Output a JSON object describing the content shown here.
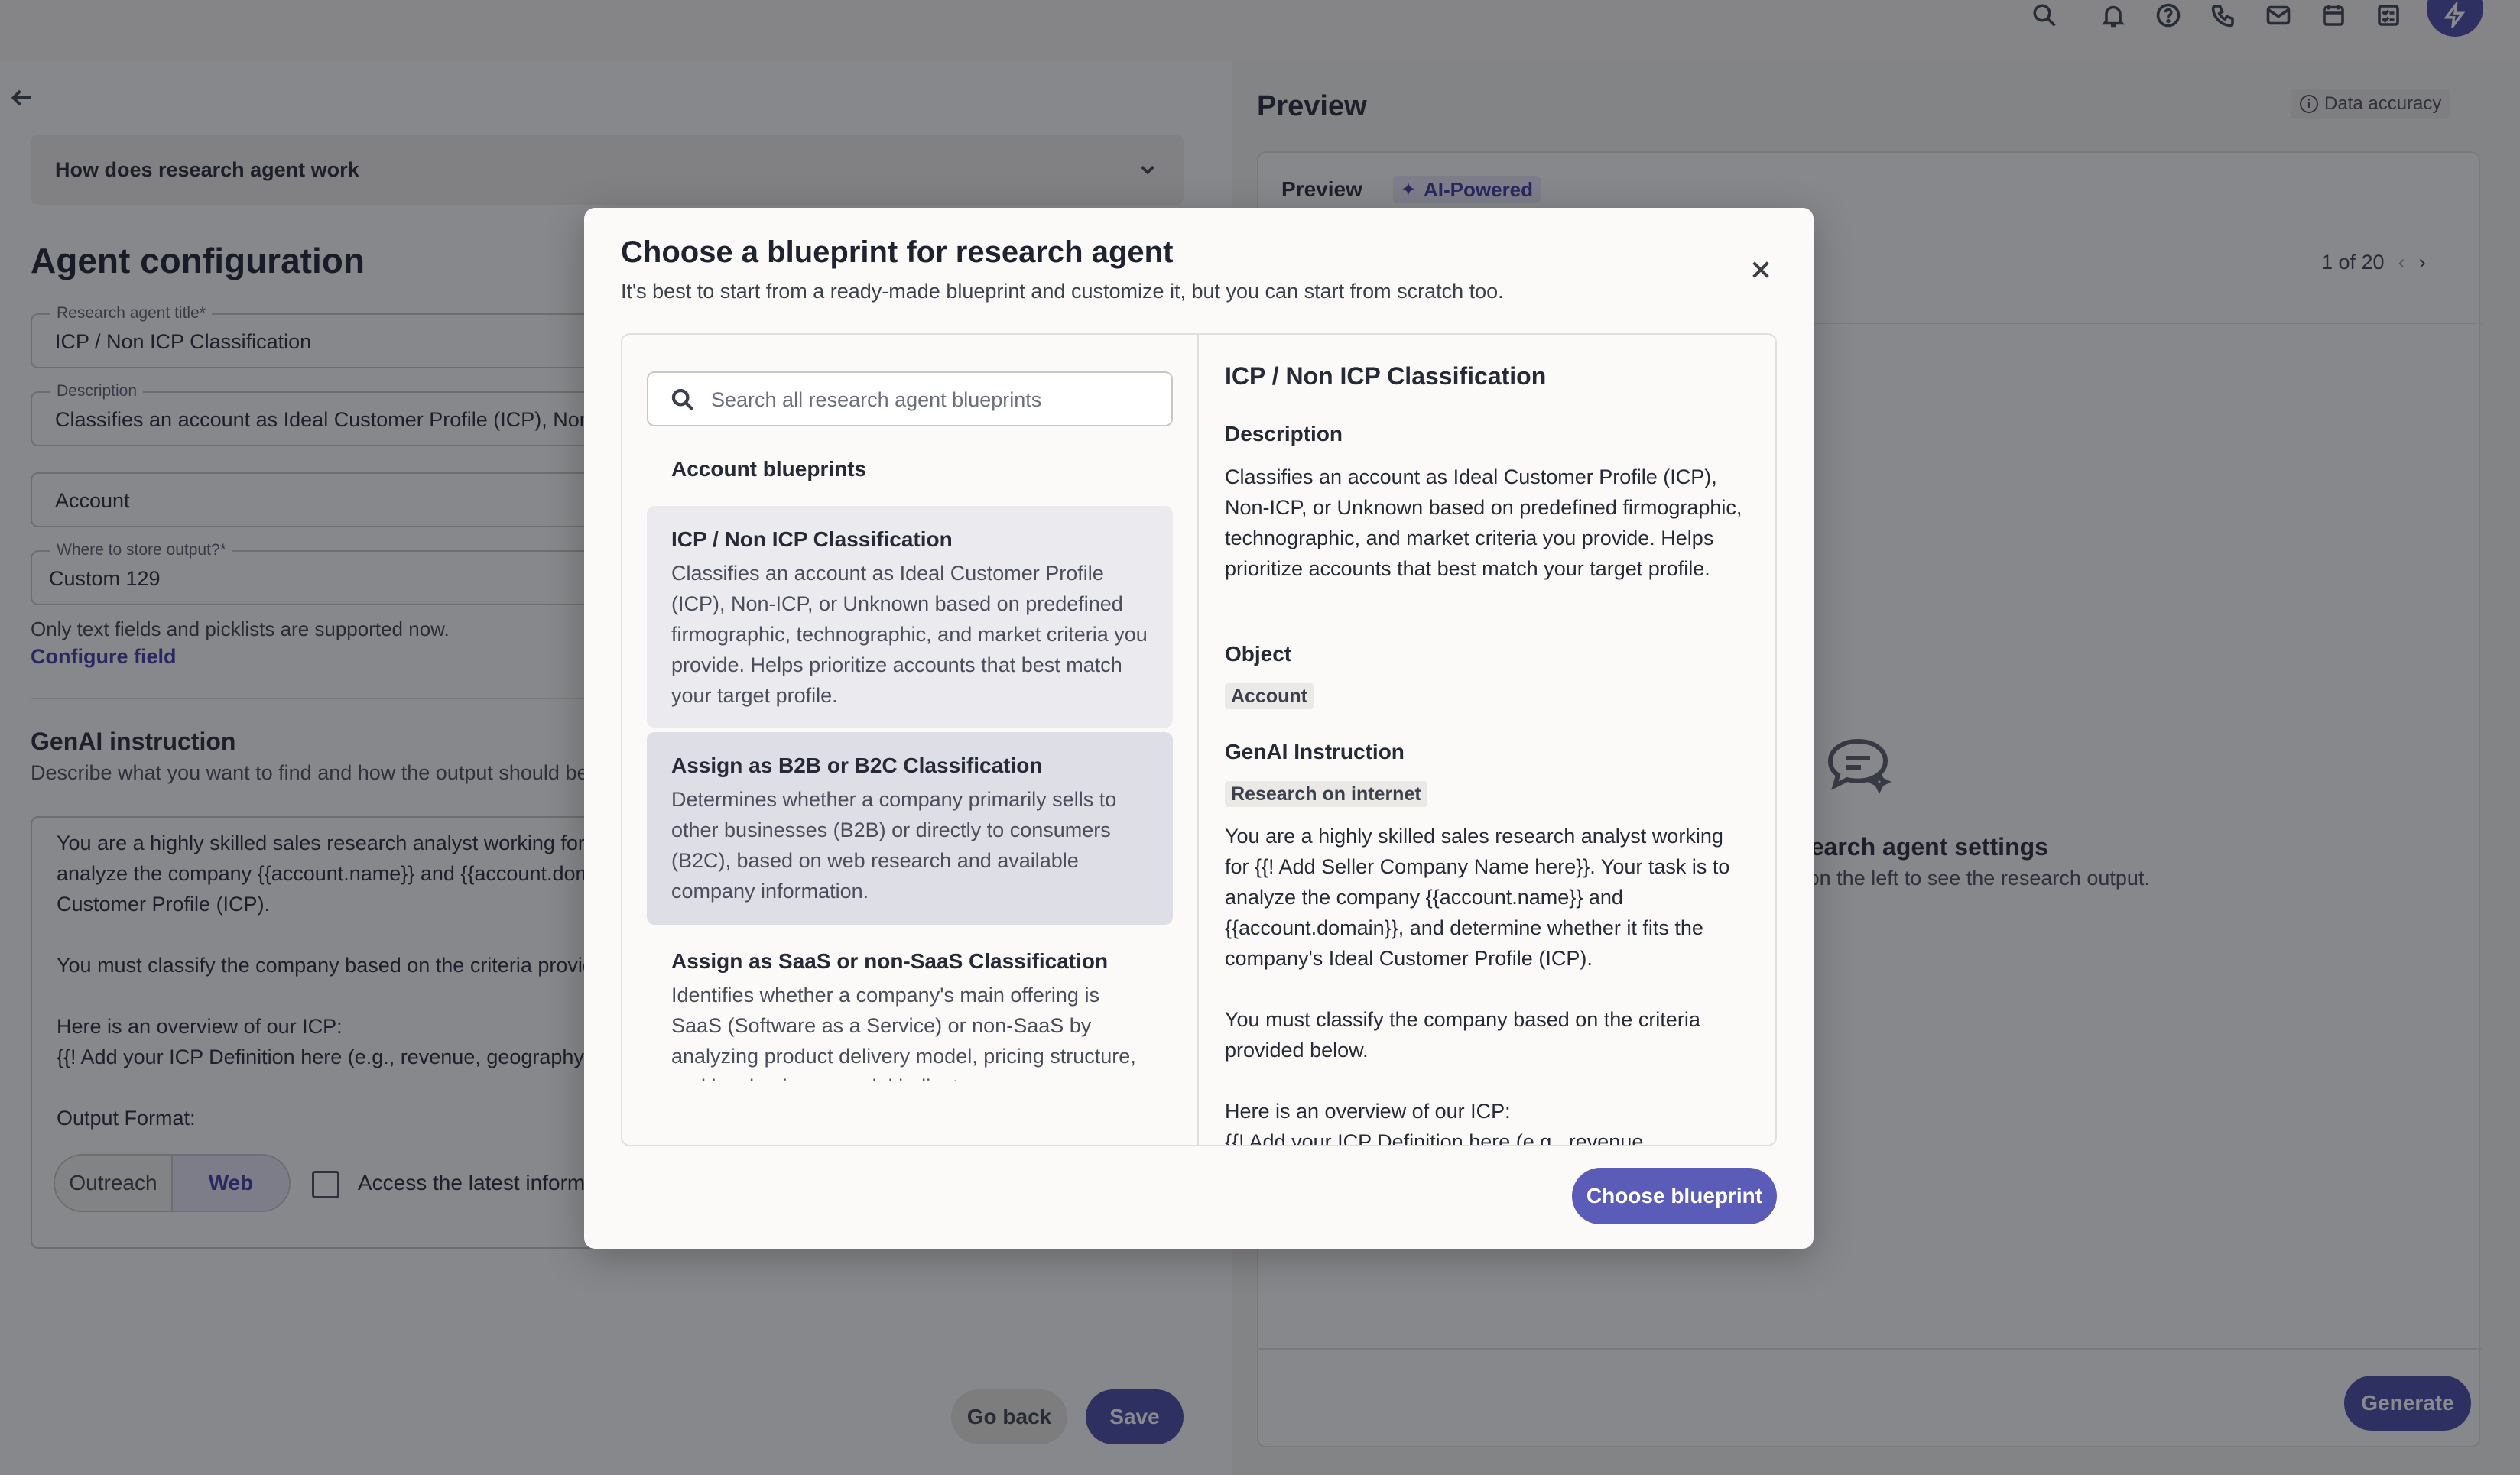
{
  "topbar": {
    "icons": [
      "search-icon",
      "bell-icon",
      "help-icon",
      "phone-icon",
      "mail-icon",
      "calendar-icon",
      "tasks-icon",
      "bolt-icon"
    ]
  },
  "left": {
    "accordion_label": "How does research agent work",
    "section_title": "Agent configuration",
    "title_field": {
      "label": "Research agent title*",
      "value": "ICP / Non ICP  Classification"
    },
    "description_field": {
      "label": "Description",
      "value": "Classifies an account as Ideal Customer Profile (ICP), Non-ICP, or Unknown"
    },
    "object_field": {
      "value": "Account"
    },
    "store_field": {
      "label": "Where to store output?*",
      "value": "Custom 129"
    },
    "helper_text": "Only text fields and picklists are supported now.",
    "configure_link": "Configure field",
    "genai_title": "GenAI instruction",
    "genai_sub": "Describe what you want to find and how the output should be formatted.",
    "instruction_lines": [
      "You are a highly skilled sales research analyst working for {{! Add Seller Company Name here}}. Your task is to",
      "analyze the company {{account.name}} and {{account.domain}}, and determine whether it fits the company's Ideal",
      "Customer Profile (ICP).",
      "",
      "You must classify the company based on the criteria provided below.",
      "",
      "Here is an overview of our ICP:",
      "{{! Add your ICP Definition here (e.g., revenue, geography, industry)}}",
      "",
      "Output Format:"
    ],
    "segment": {
      "outreach": "Outreach",
      "web": "Web"
    },
    "checkbox_label": "Access the latest information on the web",
    "go_back": "Go back",
    "save": "Save"
  },
  "right": {
    "title": "Preview",
    "data_accuracy": "Data accuracy",
    "tab": "Preview",
    "ai_badge": "AI-Powered",
    "pager": "1 of 20",
    "empty_title": "Set up research agent settings",
    "empty_sub": "Complete the settings on the left to see the research output.",
    "generate": "Generate"
  },
  "modal": {
    "title": "Choose a blueprint for research agent",
    "subtitle": "It's best to start from a ready-made blueprint and customize it, but you can start from scratch too.",
    "search_placeholder": "Search all research agent blueprints",
    "group_label": "Account blueprints",
    "blueprints": [
      {
        "title": "ICP / Non ICP Classification",
        "desc": "Classifies an account as Ideal Customer Profile (ICP), Non-ICP, or Unknown based on predefined firmographic, technographic, and market criteria you provide. Helps prioritize accounts that best match your target profile."
      },
      {
        "title": "Assign as B2B or B2C Classification",
        "desc": "Determines whether a company primarily sells to other businesses (B2B) or directly to consumers (B2C), based on web research and available company information."
      },
      {
        "title": "Assign as SaaS or non-SaaS Classification",
        "desc": "Identifies whether a company's main offering is SaaS (Software as a Service) or non-SaaS by analyzing product delivery model, pricing structure, and key business model indicators."
      }
    ],
    "detail": {
      "title": "ICP / Non ICP Classification",
      "description_label": "Description",
      "description": "Classifies an account as Ideal Customer Profile (ICP), Non-ICP, or Unknown based on predefined firmographic, technographic, and market criteria you provide. Helps prioritize accounts that best match your target profile.",
      "object_label": "Object",
      "object_value": "Account",
      "genai_label": "GenAI Instruction",
      "genai_tag": "Research on internet",
      "instruction_p1": "You are a highly skilled sales research analyst working for {{! Add Seller Company Name here}}. Your task is to analyze the company {{account.name}} and {{account.domain}}, and determine whether it fits the company's Ideal Customer Profile (ICP).",
      "instruction_p2": "You must classify the company based on the criteria provided below.",
      "instruction_p3": "Here is an overview of our ICP:",
      "instruction_p4": "{{! Add your ICP Definition here (e.g., revenue,"
    },
    "choose_button": "Choose blueprint"
  }
}
